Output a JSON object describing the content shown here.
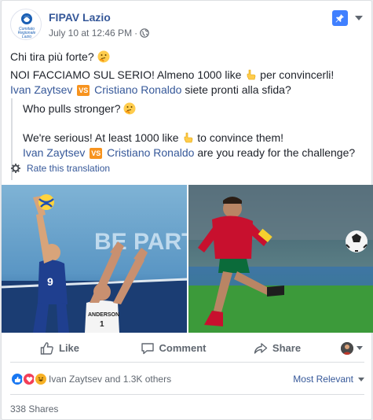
{
  "post": {
    "page_name": "FIPAV Lazio",
    "timestamp": "July 10 at 12:46 PM",
    "separator": "·",
    "avatar_text": {
      "line1": "Comitato",
      "line2": "Regionale",
      "line3": "Lazio"
    },
    "body_line1": "Chi tira più forte?",
    "body_line2": "NOI FACCIAMO SUL SERIO! Almeno 1000 like",
    "body_line2_end": "per convincerli!",
    "body_line3_name1": "Ivan Zaytsev",
    "body_line3_vs": "VS",
    "body_line3_name2": "Cristiano Ronaldo",
    "body_line3_end": "siete pronti alla sfida?"
  },
  "translation": {
    "line1": "Who pulls stronger?",
    "line2": "We're serious! At least 1000 like",
    "line2_end": "to convince them!",
    "line3_name1": "Ivan Zaytsev",
    "line3_vs": "VS",
    "line3_name2": "Cristiano Ronaldo",
    "line3_end": "are you ready for the challenge?",
    "rate_label": "Rate this translation"
  },
  "photos": {
    "left_banner": "BE PART",
    "left_jersey": "9",
    "left_jersey_name": "ANDERSON",
    "left_jersey_number": "1"
  },
  "actions": {
    "like": "Like",
    "comment": "Comment",
    "share": "Share"
  },
  "reactions": {
    "summary": "Ivan Zaytsev and 1.3K others",
    "sort_label": "Most Relevant"
  },
  "shares": {
    "count_label": "338 Shares"
  },
  "colors": {
    "link": "#365899",
    "pin": "#4080ff",
    "like_blue": "#1877f2",
    "love_red": "#f33e58",
    "haha_yellow": "#f7b125",
    "vs_orange": "#f7931e"
  }
}
